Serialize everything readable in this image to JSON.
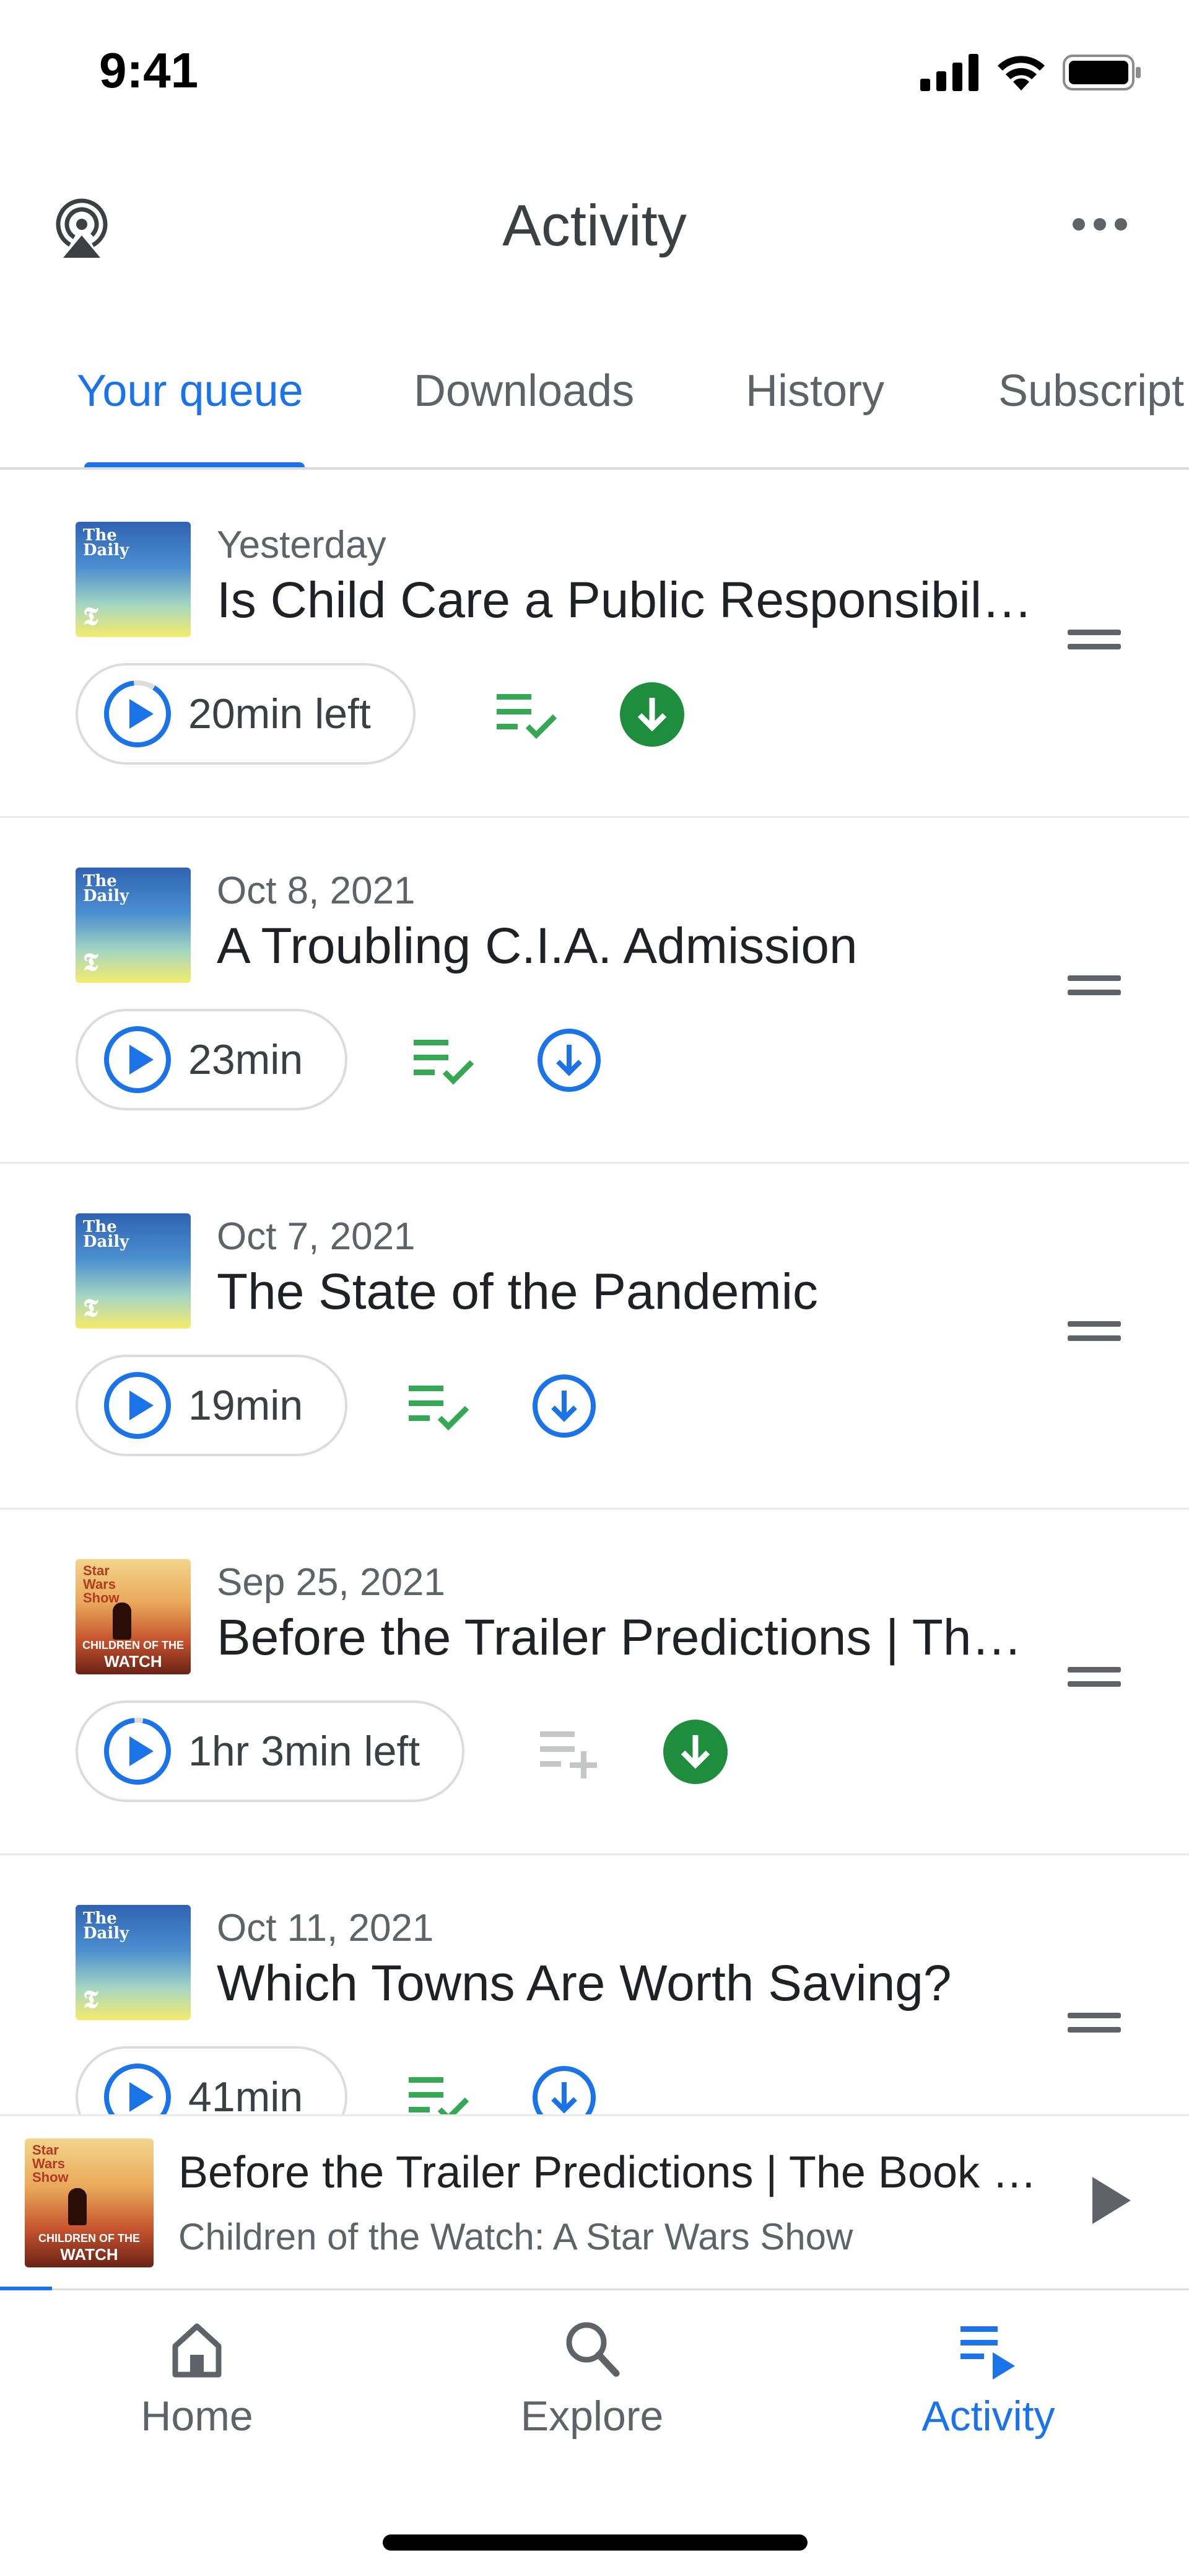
{
  "status_bar": {
    "time": "9:41"
  },
  "header": {
    "title": "Activity"
  },
  "tabs": [
    {
      "label": "Your queue",
      "active": true
    },
    {
      "label": "Downloads",
      "active": false
    },
    {
      "label": "History",
      "active": false
    },
    {
      "label": "Subscript",
      "active": false
    }
  ],
  "thumbs": {
    "daily": {
      "name_line1": "The",
      "name_line2": "Daily",
      "logo": "𝕿"
    },
    "starwars": {
      "name_line1": "Star",
      "name_line2": "Wars",
      "name_line3": "Show",
      "bottom_line1": "CHILDREN OF THE",
      "bottom_line2": "WATCH"
    }
  },
  "queue": [
    {
      "date": "Yesterday",
      "title": "Is Child Care a Public Responsibility?",
      "play_label": "20min left",
      "art": "daily",
      "queued": true,
      "downloaded": true,
      "in_progress": true
    },
    {
      "date": "Oct 8, 2021",
      "title": "A Troubling C.I.A. Admission",
      "play_label": "23min",
      "art": "daily",
      "queued": true,
      "downloaded": false,
      "in_progress": false
    },
    {
      "date": "Oct 7, 2021",
      "title": "The State of the Pandemic",
      "play_label": "19min",
      "art": "daily",
      "queued": true,
      "downloaded": false,
      "in_progress": false
    },
    {
      "date": "Sep 25, 2021",
      "title": "Before the Trailer Predictions | The Book of Boba Fett",
      "play_label": "1hr 3min left",
      "art": "starwars",
      "queued": false,
      "downloaded": true,
      "in_progress": true
    },
    {
      "date": "Oct 11, 2021",
      "title": "Which Towns Are Worth Saving?",
      "play_label": "41min",
      "art": "daily",
      "queued": true,
      "downloaded": false,
      "in_progress": false
    }
  ],
  "mini_player": {
    "title": "Before the Trailer Predictions | The Book of Boba Fett",
    "subtitle": "Children of the Watch: A Star Wars Show",
    "progress": 0.04
  },
  "bottom_nav": [
    {
      "label": "Home",
      "icon": "home-icon",
      "active": false
    },
    {
      "label": "Explore",
      "icon": "search-icon",
      "active": false
    },
    {
      "label": "Activity",
      "icon": "queue-play-icon",
      "active": true
    }
  ],
  "colors": {
    "accent": "#1a73e8",
    "queued_green": "#34a853",
    "download_green": "#1e8e3e",
    "muted": "#5f6368"
  }
}
